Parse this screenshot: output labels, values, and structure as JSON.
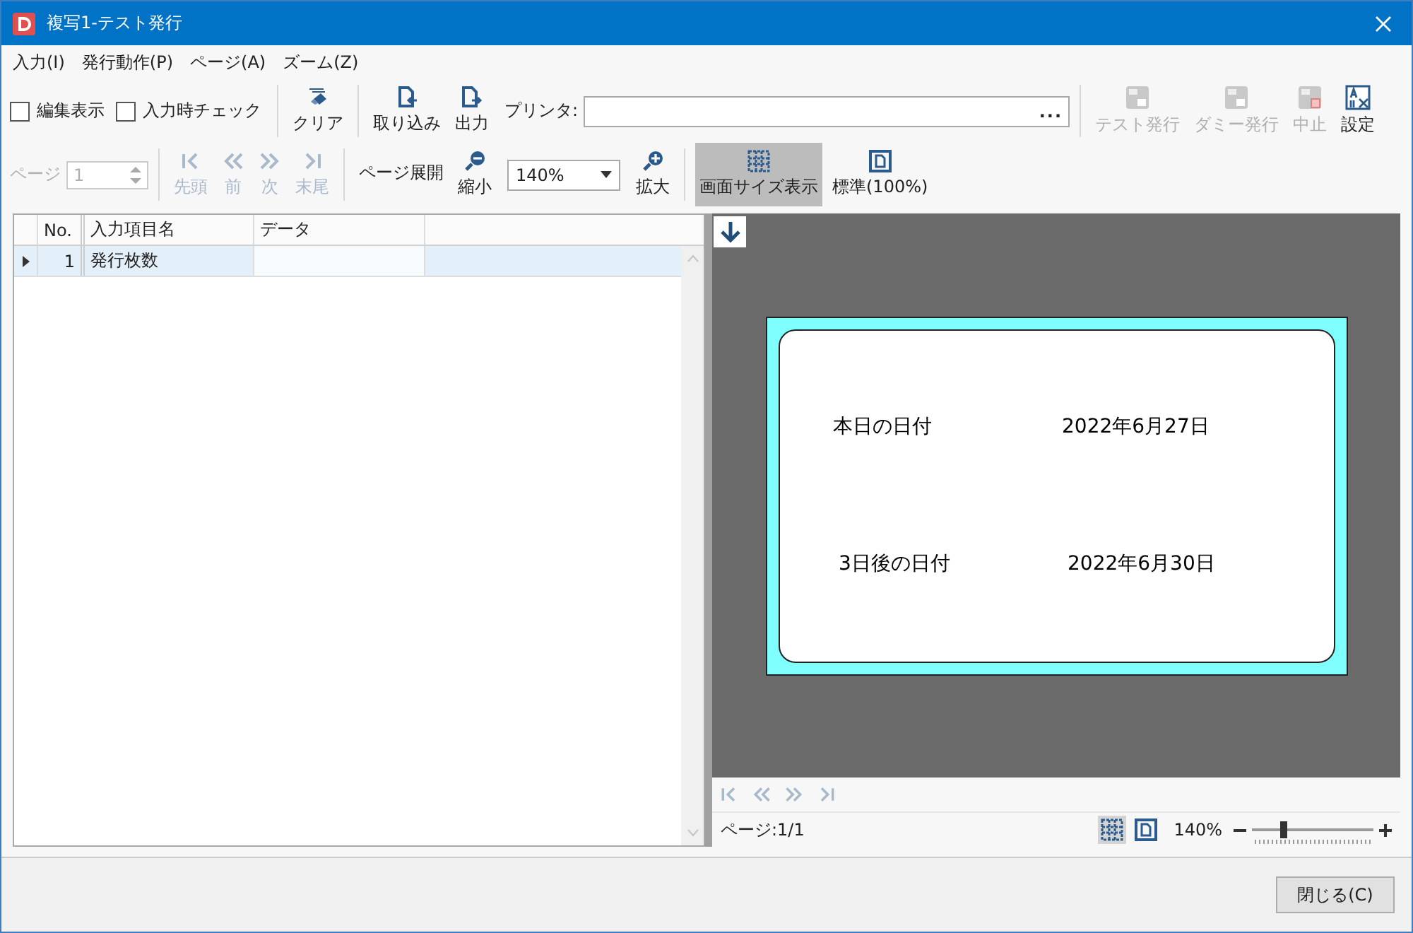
{
  "window": {
    "title": "複写1-テスト発行"
  },
  "menu": [
    "入力(I)",
    "発行動作(P)",
    "ページ(A)",
    "ズーム(Z)"
  ],
  "toolbar": {
    "checkboxes": [
      {
        "label": "編集表示",
        "checked": false
      },
      {
        "label": "入力時チェック",
        "checked": false
      }
    ],
    "clear": "クリア",
    "import": "取り込み",
    "export": "出力",
    "printer_label": "プリンタ:",
    "printer_browse": "...",
    "issue_buttons": [
      {
        "kind": "test",
        "label": "テスト発行",
        "disabled": true
      },
      {
        "kind": "dummy",
        "label": "ダミー発行",
        "disabled": true
      },
      {
        "kind": "stop",
        "label": "中止",
        "disabled": true
      },
      {
        "kind": "settings",
        "label": "設定",
        "disabled": false
      }
    ],
    "page_label": "ページ",
    "page_value": "1",
    "page_disabled": true,
    "nav": [
      {
        "kind": "first",
        "label": "先頭",
        "disabled": true
      },
      {
        "kind": "prev",
        "label": "前",
        "disabled": true
      },
      {
        "kind": "next",
        "label": "次",
        "disabled": true
      },
      {
        "kind": "last",
        "label": "末尾",
        "disabled": true
      }
    ],
    "page_spread": "ページ展開",
    "zoom_out": "縮小",
    "zoom_value": "140%",
    "zoom_in": "拡大",
    "view_buttons": [
      {
        "kind": "fit",
        "label": "画面サイズ表示",
        "selected": true
      },
      {
        "kind": "standard",
        "label": "標準(100%)",
        "selected": false
      }
    ]
  },
  "grid": {
    "columns": [
      "No.",
      "入力項目名",
      "データ"
    ],
    "rows": [
      {
        "no": "1",
        "name": "発行枚数",
        "selected": true
      }
    ]
  },
  "preview": {
    "fields": [
      {
        "label": "本日の日付",
        "value": "2022年6月27日"
      },
      {
        "label": "3日後の日付",
        "value": "2022年6月30日"
      }
    ],
    "nav": [
      {
        "kind": "first"
      },
      {
        "kind": "prev"
      },
      {
        "kind": "next"
      },
      {
        "kind": "last"
      }
    ],
    "status": "ページ:1/1",
    "view_buttons": [
      {
        "kind": "fit",
        "selected": true
      },
      {
        "kind": "standard",
        "selected": false
      }
    ],
    "zoom": "140%",
    "slider": {
      "level": 0.27
    }
  },
  "close_button": "閉じる(C)"
}
